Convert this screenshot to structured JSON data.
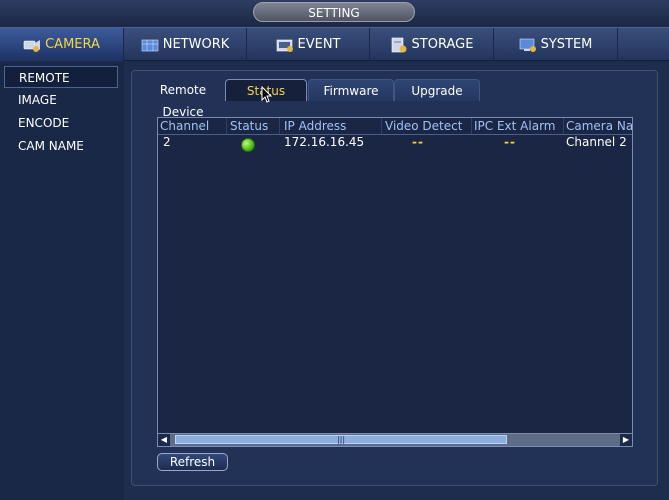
{
  "window": {
    "title": "SETTING"
  },
  "menu": [
    {
      "label": "CAMERA",
      "icon": "camera-icon",
      "active": true
    },
    {
      "label": "NETWORK",
      "icon": "network-icon"
    },
    {
      "label": "EVENT",
      "icon": "event-icon"
    },
    {
      "label": "STORAGE",
      "icon": "storage-icon"
    },
    {
      "label": "SYSTEM",
      "icon": "system-icon"
    }
  ],
  "sidebar": {
    "items": [
      {
        "label": "REMOTE",
        "active": true
      },
      {
        "label": "IMAGE"
      },
      {
        "label": "ENCODE"
      },
      {
        "label": "CAM NAME"
      }
    ]
  },
  "tabs": [
    {
      "label": "Remote Device"
    },
    {
      "label": "Status",
      "active": true
    },
    {
      "label": "Firmware"
    },
    {
      "label": "Upgrade"
    }
  ],
  "table": {
    "headers": [
      "Channel",
      "Status",
      "IP Address",
      "Video Detect",
      "IPC Ext Alarm",
      "Camera Nar"
    ],
    "rows": [
      {
        "channel": "2",
        "status": "online",
        "ip": "172.16.16.45",
        "video_detect": "--",
        "ipc_ext_alarm": "--",
        "camera_name": "Channel 2"
      }
    ],
    "scroll_grip": "|||",
    "scroll_left": "◀",
    "scroll_right": "▶"
  },
  "buttons": {
    "refresh": "Refresh"
  },
  "colors": {
    "active_text": "#f3d64a",
    "header_text": "#9fc2f7",
    "status_online": "#3eaa10"
  }
}
